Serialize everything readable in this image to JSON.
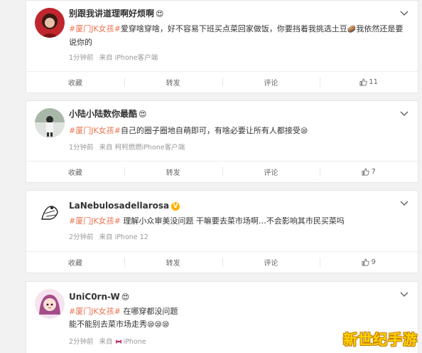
{
  "posts": [
    {
      "username": "别跟我讲道理啊好烦啊",
      "username_emoji": "😍",
      "tag": "#厦门JK女孩#",
      "text": "爱穿啥穿啥，好不容易下班买点菜回家做饭，你要挡着我挑选土豆",
      "text_emoji": "🥔",
      "text_after": "我依然还是要说你的",
      "time": "1分钟前",
      "source": "来自 iPhone客户端",
      "actions": {
        "collect": "收藏",
        "repost": "转发",
        "comment": "评论",
        "likes": "11"
      }
    },
    {
      "username": "小陆小陆数你最酷",
      "username_emoji": "😍",
      "tag": "#厦门JK女孩#",
      "text": "自己的圈子圈地自萌即可，有啥必要让所有人都接受",
      "text_emoji": "😪",
      "time": "1分钟前",
      "source": "来自 柯柯燃燃iPhone客户端",
      "actions": {
        "collect": "收藏",
        "repost": "转发",
        "comment": "评论",
        "likes": "7"
      }
    },
    {
      "username": "LaNebulosadellarosa",
      "username_badge": "V",
      "tag": "#厦门JK女孩#",
      "text": " 理解小众审美没问题 干嘛要去菜市场啊…不会影响其市民买菜吗",
      "time": "2分钟前",
      "source": "来自 iPhone 12",
      "actions": {
        "collect": "收藏",
        "repost": "转发",
        "comment": "评论",
        "likes": "9"
      }
    },
    {
      "username": "UniC0rn-W",
      "username_emoji": "😍",
      "tag": "#厦门JK女孩#",
      "text": " 在哪穿都没问题",
      "text_line2": "能不能别去菜市场走秀",
      "text_emoji": "😪😪😪",
      "time": "2分钟前",
      "source_prefix": "来自",
      "source_icon": "bow-icon",
      "source": "iPhone"
    }
  ],
  "watermark": "新世纪手游",
  "colors": {
    "tag": "#eb7350",
    "meta": "#999999",
    "background": "#f2f2f2"
  }
}
